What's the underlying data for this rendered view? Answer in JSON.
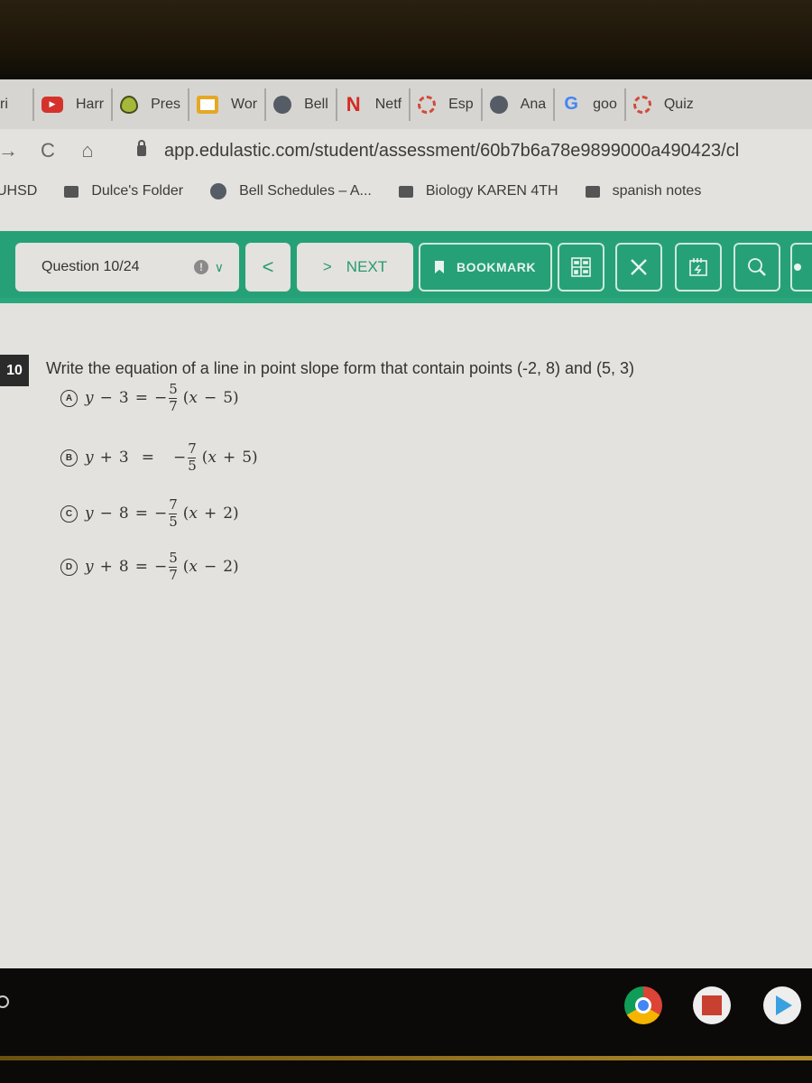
{
  "tabs": [
    {
      "label": "ri",
      "icon": "partial-tab"
    },
    {
      "label": "Harr",
      "icon": "youtube-icon"
    },
    {
      "label": "Pres",
      "icon": "pear-deck-icon"
    },
    {
      "label": "Wor",
      "icon": "google-slides-icon"
    },
    {
      "label": "Bell",
      "icon": "globe-icon"
    },
    {
      "label": "Netf",
      "icon": "netflix-icon"
    },
    {
      "label": "Esp",
      "icon": "edulastic-ring-icon"
    },
    {
      "label": "Ana",
      "icon": "globe-icon"
    },
    {
      "label": "goo",
      "icon": "google-icon"
    },
    {
      "label": "Quiz",
      "icon": "edulastic-ring-icon"
    }
  ],
  "address_bar": {
    "url": "app.edulastic.com/student/assessment/60b7b6a78e9899000a490423/cl"
  },
  "bookmarks": [
    {
      "label": "UHSD",
      "icon": "none"
    },
    {
      "label": "Dulce's Folder",
      "icon": "folder-icon"
    },
    {
      "label": "Bell Schedules – A...",
      "icon": "globe-icon"
    },
    {
      "label": "Biology KAREN 4TH",
      "icon": "folder-icon"
    },
    {
      "label": "spanish notes",
      "icon": "folder-icon"
    }
  ],
  "toolbar": {
    "question_label": "Question 10/24",
    "prev_symbol": "<",
    "next_symbol": ">",
    "next_label": "NEXT",
    "bookmark_label": "BOOKMARK",
    "accent_color": "#26a177"
  },
  "question": {
    "number": "10",
    "text": "Write the equation of a line in point slope form that contain points (-2, 8) and (5, 3)",
    "options": [
      {
        "letter": "A",
        "lhs_var": "y",
        "lhs_op": "−",
        "lhs_num": "3",
        "sign": "−",
        "num": "5",
        "den": "7",
        "x_var": "x",
        "x_op": "−",
        "x_num": "5"
      },
      {
        "letter": "B",
        "lhs_var": "y",
        "lhs_op": "+",
        "lhs_num": "3",
        "sign": "−",
        "num": "7",
        "den": "5",
        "x_var": "x",
        "x_op": "+",
        "x_num": "5"
      },
      {
        "letter": "C",
        "lhs_var": "y",
        "lhs_op": "−",
        "lhs_num": "8",
        "sign": "−",
        "num": "7",
        "den": "5",
        "x_var": "x",
        "x_op": "+",
        "x_num": "2"
      },
      {
        "letter": "D",
        "lhs_var": "y",
        "lhs_op": "+",
        "lhs_num": "8",
        "sign": "−",
        "num": "5",
        "den": "7",
        "x_var": "x",
        "x_op": "−",
        "x_num": "2"
      }
    ]
  },
  "shelf": {
    "apps": [
      "chrome",
      "edulastic",
      "play-store"
    ]
  }
}
